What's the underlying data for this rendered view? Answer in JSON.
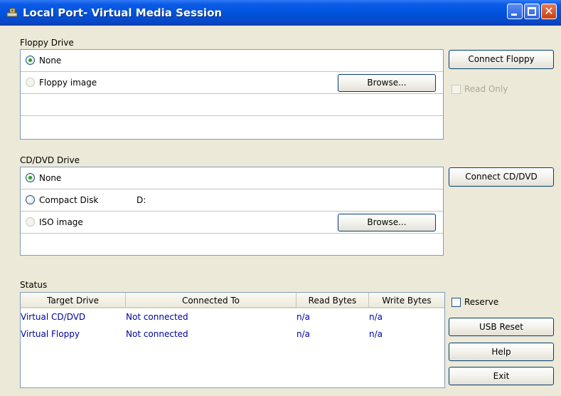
{
  "window": {
    "title": "Local Port- Virtual Media Session",
    "controls": {
      "minimize": "",
      "maximize": "",
      "close": "✕"
    }
  },
  "floppy": {
    "label": "Floppy Drive",
    "options": [
      {
        "label": "None",
        "selected": true,
        "enabled": true
      },
      {
        "label": "Floppy image",
        "selected": false,
        "enabled": false
      }
    ],
    "browse_label": "Browse...",
    "connect_label": "Connect Floppy",
    "read_only_label": "Read Only"
  },
  "cddvd": {
    "label": "CD/DVD Drive",
    "options": [
      {
        "label": "None",
        "selected": true,
        "enabled": true
      },
      {
        "label": "Compact Disk",
        "selected": false,
        "enabled": true,
        "drive": "D:"
      },
      {
        "label": "ISO image",
        "selected": false,
        "enabled": false
      }
    ],
    "browse_label": "Browse...",
    "connect_label": "Connect CD/DVD"
  },
  "status": {
    "label": "Status",
    "columns": [
      "Target Drive",
      "Connected To",
      "Read Bytes",
      "Write Bytes"
    ],
    "rows": [
      {
        "target": "Virtual CD/DVD",
        "connected": "Not connected",
        "read": "n/a",
        "write": "n/a"
      },
      {
        "target": "Virtual Floppy",
        "connected": "Not connected",
        "read": "n/a",
        "write": "n/a"
      }
    ]
  },
  "side": {
    "reserve_label": "Reserve",
    "usb_reset_label": "USB Reset",
    "help_label": "Help",
    "exit_label": "Exit"
  },
  "colors": {
    "titlebar": "#0052db",
    "window_bg": "#ece9d8",
    "table_text": "#0000a0",
    "radio_checked": "#21a121"
  }
}
